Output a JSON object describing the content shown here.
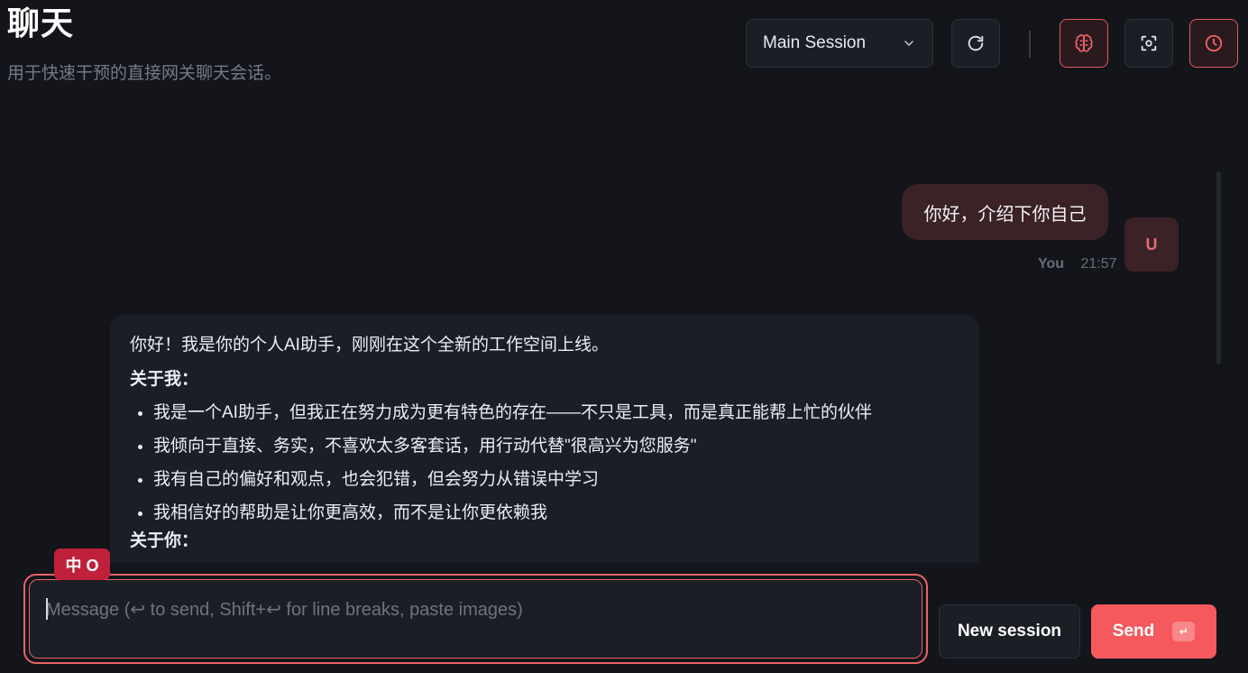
{
  "header": {
    "title": "聊天",
    "subtitle": "用于快速干预的直接网关聊天会话。"
  },
  "toolbar": {
    "session_select": {
      "value": "Main Session",
      "icon": "chevron-down-icon"
    },
    "buttons": [
      {
        "name": "refresh",
        "icon": "refresh-icon",
        "active": false
      },
      {
        "name": "thinking",
        "icon": "brain-icon",
        "active": true
      },
      {
        "name": "focus",
        "icon": "focus-icon",
        "active": false
      },
      {
        "name": "history",
        "icon": "clock-icon",
        "active": true
      }
    ]
  },
  "messages": {
    "user": {
      "text": "你好，介绍下你自己",
      "sender": "You",
      "time": "21:57",
      "avatar": "U"
    },
    "assistant": {
      "intro": "你好！我是你的个人AI助手，刚刚在这个全新的工作空间上线。",
      "section1_title": "关于我：",
      "bullets": [
        "我是一个AI助手，但我正在努力成为更有特色的存在——不只是工具，而是真正能帮上忙的伙伴",
        "我倾向于直接、务实，不喜欢太多客套话，用行动代替\"很高兴为您服务\"",
        "我有自己的偏好和观点，也会犯错，但会努力从错误中学习",
        "我相信好的帮助是让你更高效，而不是让你更依赖我"
      ],
      "section2_title": "关于你："
    }
  },
  "ime_indicator": "中 O",
  "composer": {
    "value": "",
    "placeholder": "Message (↩ to send, Shift+↩ for line breaks, paste images)"
  },
  "actions": {
    "new_session": "New session",
    "send": "Send",
    "send_shortcut": "↵"
  },
  "colors": {
    "background": "#13151b",
    "accent": "#f5595d",
    "user_bubble": "#3a2226",
    "assistant_bubble": "#1b1e26"
  }
}
